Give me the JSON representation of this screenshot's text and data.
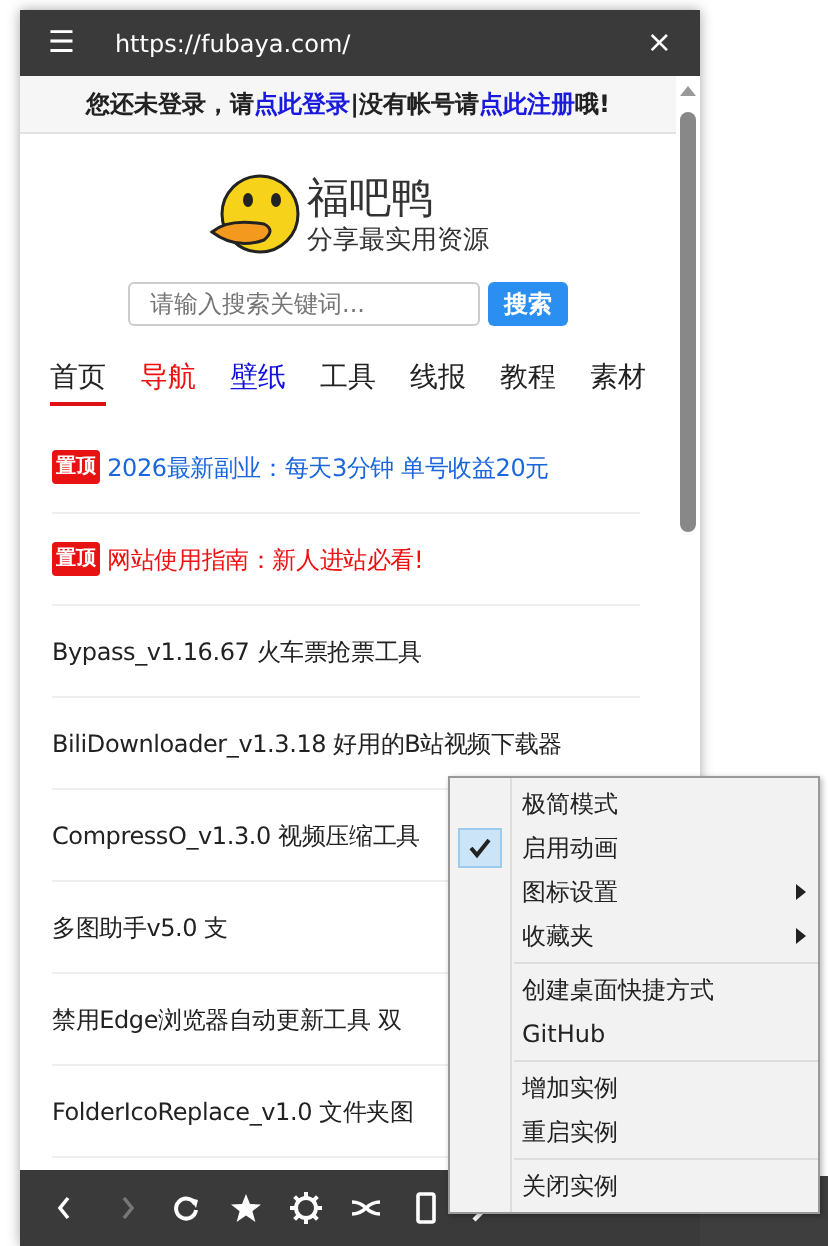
{
  "title_bar": {
    "menu_glyph": "☰",
    "url": "https://fubaya.com/",
    "close_glyph": "×"
  },
  "login_bar": [
    {
      "text": "您还未登录，请",
      "kind": "plain"
    },
    {
      "text": "点此登录",
      "kind": "link"
    },
    {
      "text": "|",
      "kind": "plain"
    },
    {
      "text": "没有帐号请",
      "kind": "plain"
    },
    {
      "text": "点此注册",
      "kind": "link"
    },
    {
      "text": "哦!",
      "kind": "plain"
    }
  ],
  "site": {
    "name": "福吧鸭",
    "slogan": "分享最实用资源"
  },
  "search": {
    "placeholder": "请输入搜索关键词...",
    "button": "搜索"
  },
  "nav": [
    {
      "label": "首页",
      "color": "#222222",
      "selected": true
    },
    {
      "label": "导航",
      "color": "#ee1111",
      "selected": false
    },
    {
      "label": "壁纸",
      "color": "#1111dd",
      "selected": false
    },
    {
      "label": "工具",
      "color": "#222222",
      "selected": false
    },
    {
      "label": "线报",
      "color": "#222222",
      "selected": false
    },
    {
      "label": "教程",
      "color": "#222222",
      "selected": false
    },
    {
      "label": "素材",
      "color": "#222222",
      "selected": false
    }
  ],
  "posts": [
    {
      "kind": "pinned",
      "badge": "置顶",
      "title": "2026最新副业：每天3分钟 单号收益20元",
      "color": "#1a66dd"
    },
    {
      "kind": "pinned",
      "badge": "置顶",
      "title": "网站使用指南：新人进站必看!",
      "color": "#ee1111"
    },
    {
      "kind": "normal",
      "title": "Bypass_v1.16.67 火车票抢票工具"
    },
    {
      "kind": "normal",
      "title": "BiliDownloader_v1.3.18 好用的B站视频下载器"
    },
    {
      "kind": "normal",
      "title": "CompressO_v1.3.0 视频压缩工具"
    },
    {
      "kind": "normal",
      "title": "多图助手v5.0 支"
    },
    {
      "kind": "normal",
      "title": "禁用Edge浏览器自动更新工具 双"
    },
    {
      "kind": "normal",
      "title": "FolderIcoReplace_v1.0 文件夹图"
    }
  ],
  "context_menu": [
    {
      "kind": "check",
      "label": "极简模式",
      "checked": false
    },
    {
      "kind": "check",
      "label": "启用动画",
      "checked": true
    },
    {
      "kind": "submenu",
      "label": "图标设置"
    },
    {
      "kind": "submenu",
      "label": "收藏夹"
    },
    {
      "kind": "separator"
    },
    {
      "kind": "item",
      "label": "创建桌面快捷方式"
    },
    {
      "kind": "item",
      "label": "GitHub"
    },
    {
      "kind": "separator"
    },
    {
      "kind": "item",
      "label": "增加实例"
    },
    {
      "kind": "item",
      "label": "重启实例"
    },
    {
      "kind": "separator"
    },
    {
      "kind": "item",
      "label": "关闭实例"
    }
  ]
}
